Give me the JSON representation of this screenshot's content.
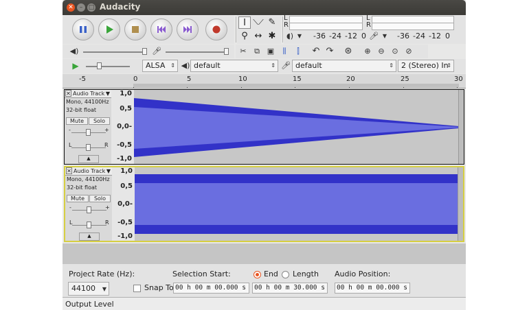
{
  "window": {
    "title": "Audacity"
  },
  "transport": {
    "buttons": [
      "pause",
      "play",
      "stop",
      "skip-to-start",
      "skip-to-end",
      "record"
    ],
    "colors": {
      "pause": "#3b62c8",
      "play": "#3aa53a",
      "stop": "#b08f4f",
      "skip": "#8a5bd0",
      "record": "#c0392b"
    }
  },
  "tools": [
    "selection-tool",
    "envelope-tool",
    "draw-tool",
    "zoom-tool",
    "timeshift-tool",
    "multi-tool"
  ],
  "meters": {
    "record": {
      "l": "L",
      "r": "R",
      "scale": [
        "-36",
        "-24",
        "-12",
        "0"
      ]
    },
    "playback": {
      "l": "L",
      "r": "R",
      "scale": [
        "-36",
        "-24",
        "-12",
        "0"
      ]
    }
  },
  "device": {
    "host": "ALSA",
    "playback_device": "default",
    "recording_device": "default",
    "channels": "2 (Stereo) In"
  },
  "ruler": {
    "labels": [
      "-5",
      "0",
      "5",
      "10",
      "15",
      "20",
      "25",
      "30"
    ]
  },
  "tracks": [
    {
      "name": "Audio Track",
      "info1": "Mono, 44100Hz",
      "info2": "32-bit float",
      "mute": "Mute",
      "solo": "Solo",
      "gain_label_l": "L",
      "gain_label_r": "R",
      "axis": [
        "1,0",
        "0,5",
        "0,0-",
        "-0,5",
        "-1,0"
      ]
    },
    {
      "name": "Audio Track",
      "info1": "Mono, 44100Hz",
      "info2": "32-bit float",
      "mute": "Mute",
      "solo": "Solo",
      "gain_label_l": "L",
      "gain_label_r": "R",
      "axis": [
        "1,0",
        "0,5",
        "0,0-",
        "-0,5",
        "-1,0"
      ]
    }
  ],
  "selection_bar": {
    "project_rate_label": "Project Rate (Hz):",
    "project_rate": "44100",
    "snap_to": "Snap To",
    "selection_start_label": "Selection Start:",
    "end_label": "End",
    "length_label": "Length",
    "audio_position_label": "Audio Position:",
    "start_value": "00 h 00 m 00.000 s",
    "end_value": "00 h 00 m 30.000 s",
    "audio_position_value": "00 h 00 m 00.000 s"
  },
  "status": {
    "text": "Output Level"
  },
  "colors": {
    "wave": "#6a6ee0",
    "wave_dark": "#3232c8",
    "accent": "#e95420",
    "selected_border": "#d6cf42"
  }
}
